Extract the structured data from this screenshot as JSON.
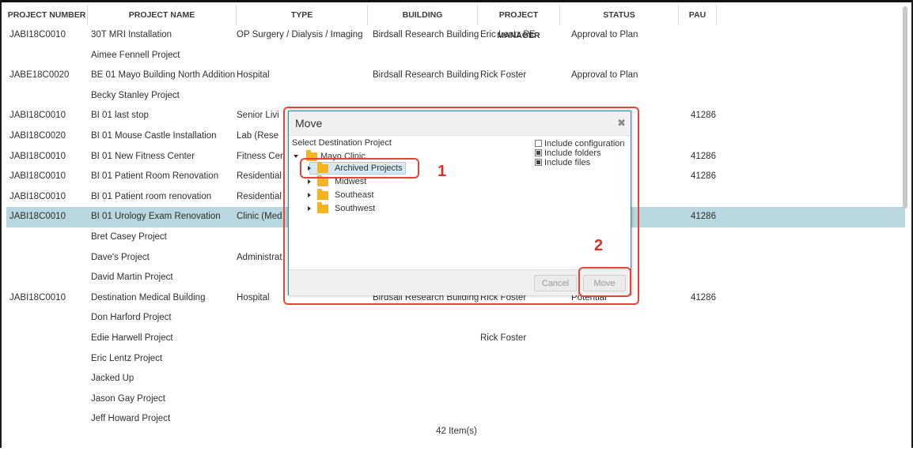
{
  "table": {
    "columns": [
      "PROJECT NUMBER",
      "PROJECT NAME",
      "TYPE",
      "BUILDING",
      "PROJECT MANAGER",
      "STATUS",
      "PAU"
    ],
    "rows": [
      {
        "number": "JABI18C0010",
        "name": "30T MRI Installation",
        "type": "OP Surgery / Dialysis / Imaging",
        "building": "Birdsall Research Building",
        "manager": "Eric Lentz PE",
        "status": "Approval to Plan",
        "pau": ""
      },
      {
        "number": "",
        "name": "Aimee Fennell Project",
        "type": "",
        "building": "",
        "manager": "",
        "status": "",
        "pau": ""
      },
      {
        "number": "JABE18C0020",
        "name": "BE 01 Mayo Building North Addition",
        "type": "Hospital",
        "building": "Birdsall Research Building",
        "manager": "Rick Foster",
        "status": "Approval to Plan",
        "pau": ""
      },
      {
        "number": "",
        "name": "Becky Stanley Project",
        "type": "",
        "building": "",
        "manager": "",
        "status": "",
        "pau": ""
      },
      {
        "number": "JABI18C0010",
        "name": "BI 01 last stop",
        "type": "Senior Livi",
        "building": "",
        "manager": "",
        "status": "",
        "pau": "41286"
      },
      {
        "number": "JABI18C0020",
        "name": "BI 01 Mouse Castle Installation",
        "type": "Lab (Rese",
        "building": "",
        "manager": "",
        "status": "",
        "pau": ""
      },
      {
        "number": "JABI18C0010",
        "name": "BI 01 New Fitness Center",
        "type": "Fitness Cer",
        "building": "",
        "manager": "",
        "status": "",
        "pau": "41286"
      },
      {
        "number": "JABI18C0010",
        "name": "BI 01 Patient Room Renovation",
        "type": "Residential",
        "building": "",
        "manager": "",
        "status": "",
        "pau": "41286"
      },
      {
        "number": "JABI18C0010",
        "name": "BI 01 Patient room renovation",
        "type": "Residential",
        "building": "",
        "manager": "",
        "status": "",
        "pau": ""
      },
      {
        "number": "JABI18C0010",
        "name": "BI 01 Urology Exam Renovation",
        "type": "Clinic (Med",
        "building": "",
        "manager": "",
        "status": "",
        "pau": "41286",
        "selected": true
      },
      {
        "number": "",
        "name": "Bret Casey Project",
        "type": "",
        "building": "",
        "manager": "",
        "status": "",
        "pau": ""
      },
      {
        "number": "",
        "name": "Dave's Project",
        "type": "Administrat",
        "building": "",
        "manager": "",
        "status": "",
        "pau": ""
      },
      {
        "number": "",
        "name": "David Martin Project",
        "type": "",
        "building": "",
        "manager": "",
        "status": "",
        "pau": ""
      },
      {
        "number": "JABI18C0010",
        "name": "Destination Medical Building",
        "type": "Hospital",
        "building": "Birdsall Research Building",
        "manager": "Rick Foster",
        "status": "Potential",
        "pau": "41286"
      },
      {
        "number": "",
        "name": "Don Harford Project",
        "type": "",
        "building": "",
        "manager": "",
        "status": "",
        "pau": ""
      },
      {
        "number": "",
        "name": "Edie Harwell Project",
        "type": "",
        "building": "",
        "manager": "Rick Foster",
        "status": "",
        "pau": ""
      },
      {
        "number": "",
        "name": "Eric Lentz Project",
        "type": "",
        "building": "",
        "manager": "",
        "status": "",
        "pau": ""
      },
      {
        "number": "",
        "name": "Jacked Up",
        "type": "",
        "building": "",
        "manager": "",
        "status": "",
        "pau": ""
      },
      {
        "number": "",
        "name": "Jason Gay Project",
        "type": "",
        "building": "",
        "manager": "",
        "status": "",
        "pau": ""
      },
      {
        "number": "",
        "name": "Jeff Howard Project",
        "type": "",
        "building": "",
        "manager": "",
        "status": "",
        "pau": ""
      }
    ],
    "footer": "42 Item(s)"
  },
  "dialog": {
    "title": "Move",
    "close_icon": "close-icon",
    "select_label": "Select Destination Project",
    "tree": {
      "root": "Mayo Clinic",
      "children": [
        "Archived Projects",
        "Midwest",
        "Southeast",
        "Southwest"
      ],
      "selected": "Archived Projects"
    },
    "options": [
      {
        "label": "Include configuration",
        "checked": false
      },
      {
        "label": "Include folders",
        "checked": true
      },
      {
        "label": "Include files",
        "checked": true
      }
    ],
    "cancel_label": "Cancel",
    "move_label": "Move"
  },
  "annotations": {
    "step1": "1",
    "step2": "2",
    "color": "#e0453a"
  },
  "colors": {
    "selected_row": "#b9d7df",
    "folder": "#f5b31e",
    "dialog_border": "#2e8bb0"
  }
}
